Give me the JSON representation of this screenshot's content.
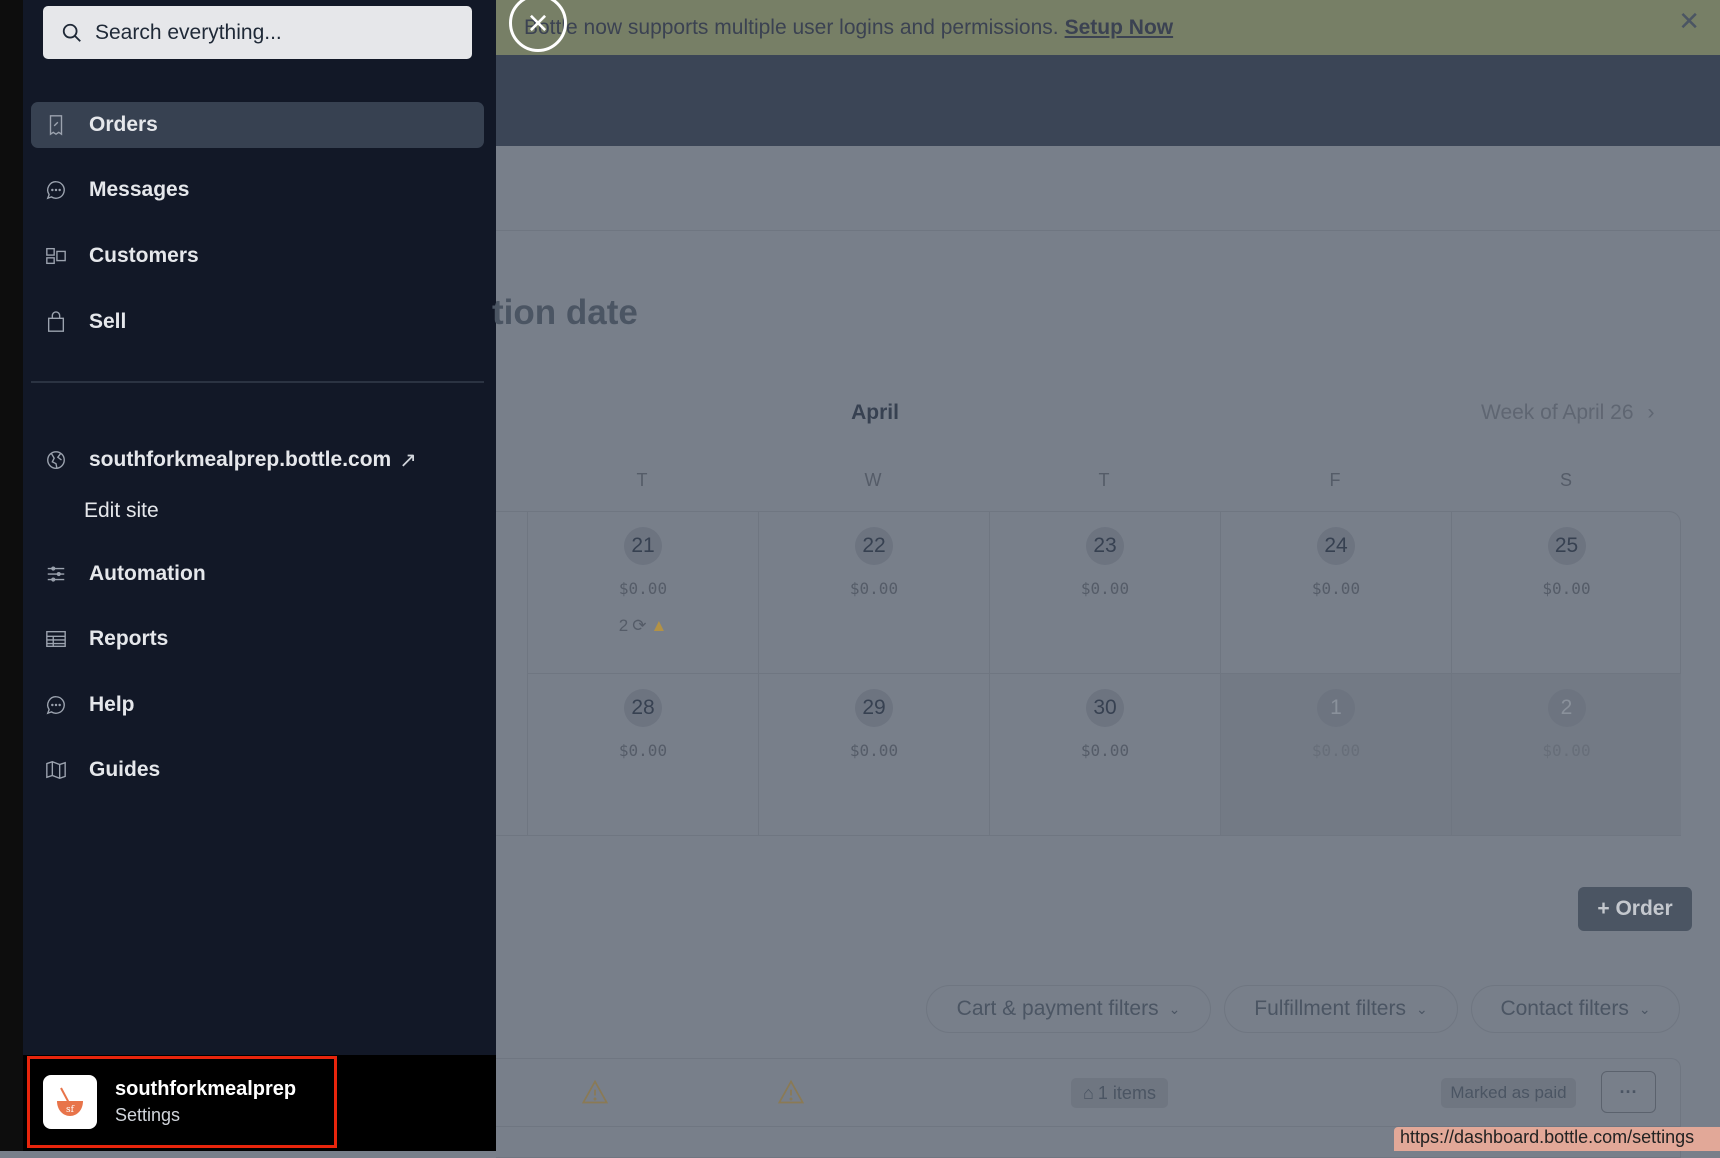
{
  "sidebar": {
    "search_placeholder": "Search everything...",
    "primary": [
      {
        "label": "Orders",
        "icon": "receipt-icon",
        "active": true
      },
      {
        "label": "Messages",
        "icon": "chat-icon"
      },
      {
        "label": "Customers",
        "icon": "customers-icon"
      },
      {
        "label": "Sell",
        "icon": "shopping-bag-icon"
      }
    ],
    "site_link": "southforkmealprep.bottle.com",
    "edit_site": "Edit site",
    "secondary": [
      {
        "label": "Automation",
        "icon": "sliders-icon"
      },
      {
        "label": "Reports",
        "icon": "table-icon"
      },
      {
        "label": "Help",
        "icon": "chat-icon"
      },
      {
        "label": "Guides",
        "icon": "map-icon"
      }
    ],
    "account": {
      "name": "southforkmealprep",
      "sub": "Settings"
    }
  },
  "banner": {
    "text": "Bottle now supports multiple user logins and permissions.",
    "link": "Setup Now"
  },
  "main": {
    "title": "tion date",
    "month": "April",
    "week_nav": "Week of April 26",
    "day_letters": [
      "T",
      "W",
      "T",
      "F",
      "S"
    ],
    "weeks": [
      [
        {
          "day": "21",
          "amount": "$0.00",
          "extra_count": "2"
        },
        {
          "day": "22",
          "amount": "$0.00"
        },
        {
          "day": "23",
          "amount": "$0.00"
        },
        {
          "day": "24",
          "amount": "$0.00"
        },
        {
          "day": "25",
          "amount": "$0.00"
        }
      ],
      [
        {
          "day": "28",
          "amount": "$0.00"
        },
        {
          "day": "29",
          "amount": "$0.00"
        },
        {
          "day": "30",
          "amount": "$0.00"
        },
        {
          "day": "1",
          "amount": "$0.00",
          "dim": true
        },
        {
          "day": "2",
          "amount": "$0.00",
          "dim": true
        }
      ]
    ],
    "add_order": "+ Order",
    "filters": [
      "Cart & payment filters",
      "Fulfillment filters",
      "Contact filters"
    ],
    "row": {
      "items": "1 items",
      "status": "Marked as paid",
      "more": "···"
    }
  },
  "status_url": "https://dashboard.bottle.com/settings",
  "colors": {
    "sidebar": "#121827",
    "highlight": "#e8250c",
    "banner": "#777f66"
  }
}
